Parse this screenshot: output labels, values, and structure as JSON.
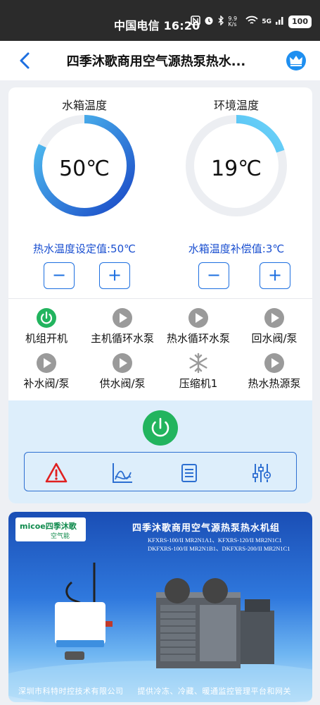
{
  "status_bar": {
    "carrier_time": "中国电信 16:20",
    "net_speed": "9.9 K/s",
    "signal": "5G",
    "battery": "100"
  },
  "nav": {
    "title": "四季沐歌商用空气源热泵热水...",
    "back_icon": "chevron-left-icon",
    "crown_icon": "crown-icon"
  },
  "gauges": [
    {
      "label": "水箱温度",
      "value": "50℃",
      "setting": "热水温度设定值:50℃",
      "fill": 0.82
    },
    {
      "label": "环境温度",
      "value": "19℃",
      "setting": "水箱温度补偿值:3℃",
      "fill": 0.2
    }
  ],
  "stepper": {
    "minus": "−",
    "plus": "+"
  },
  "status_items": [
    {
      "label": "机组开机",
      "icon": "power-icon"
    },
    {
      "label": "主机循环水泵",
      "icon": "play-icon"
    },
    {
      "label": "热水循环水泵",
      "icon": "play-icon"
    },
    {
      "label": "回水阀/泵",
      "icon": "play-icon"
    },
    {
      "label": "补水阀/泵",
      "icon": "play-icon"
    },
    {
      "label": "供水阀/泵",
      "icon": "play-icon"
    },
    {
      "label": "压缩机1",
      "icon": "snowflake-icon"
    },
    {
      "label": "热水热源泵",
      "icon": "play-icon"
    }
  ],
  "toolbar": {
    "alarm_icon": "alarm-icon",
    "chart_icon": "curve-chart-icon",
    "list_icon": "list-icon",
    "settings_icon": "sliders-icon"
  },
  "banner": {
    "logo_text": "micoe四季沐歌",
    "logo_sub": "空气能",
    "title": "四季沐歌商用空气源热泵热水机组",
    "models": [
      "KFXRS-100/II MR2N1A1、KFXRS-120/II MR2N1C1",
      "DKFXRS-100/II MR2N1B1、DKFXRS-200/II MR2N1C1"
    ],
    "footer_company": "深圳市科特时控技术有限公司",
    "footer_slogan": "提供冷冻、冷藏、暖通监控管理平台和网关"
  },
  "colors": {
    "accent": "#1d6fe0",
    "power_green": "#22b45e",
    "alarm_red": "#e02020"
  }
}
